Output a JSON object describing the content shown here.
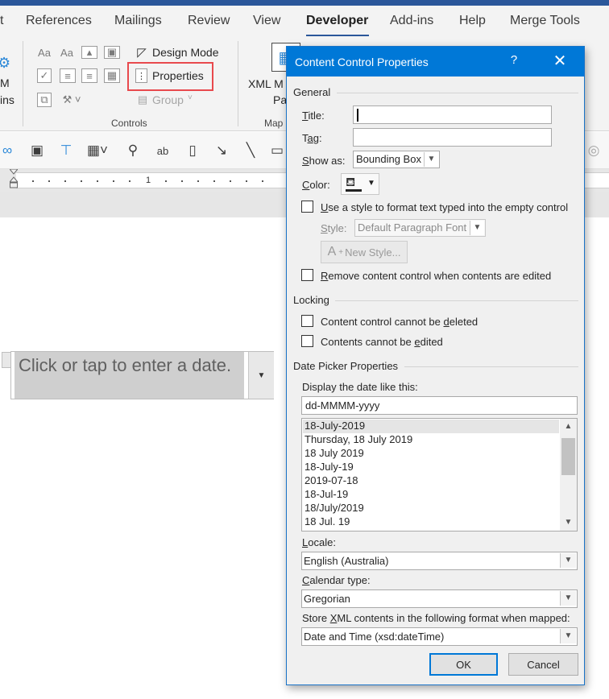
{
  "ribbon_tabs": [
    "t",
    "References",
    "Mailings",
    "Review",
    "View",
    "Developer",
    "Add-ins",
    "Help",
    "Merge Tools"
  ],
  "active_tab": "Developer",
  "ribbon": {
    "left_cut_1": "M",
    "left_cut_2": "ins",
    "design_mode": "Design Mode",
    "properties": "Properties",
    "group": "Group",
    "controls_group": "Controls",
    "xml_mapping": "XML M",
    "xml_mapping_2": "Pa",
    "mapping_group": "Map"
  },
  "ruler": {
    "mark": "1"
  },
  "document": {
    "placeholder": "Click or tap to enter a date."
  },
  "dialog": {
    "title": "Content Control Properties",
    "help": "?",
    "close": "✕",
    "general": {
      "heading": "General",
      "title_label": "Title:",
      "tag_label": "Tag:",
      "show_as_label": "Show as:",
      "show_as_value": "Bounding Box",
      "color_label": "Color:",
      "use_style_label": "Use a style to format text typed into the empty control",
      "style_label": "Style:",
      "style_value": "Default Paragraph Font",
      "new_style_button": "New Style...",
      "remove_label": "Remove content control when contents are edited"
    },
    "locking": {
      "heading": "Locking",
      "cannot_delete": "Content control cannot be deleted",
      "cannot_edit": "Contents cannot be edited"
    },
    "date_picker": {
      "heading": "Date Picker Properties",
      "display_label": "Display the date like this:",
      "format_value": "dd-MMMM-yyyy",
      "formats": [
        "18-July-2019",
        "Thursday, 18 July 2019",
        "18 July 2019",
        "18-July-19",
        "2019-07-18",
        "18-Jul-19",
        "18/July/2019",
        "18 Jul. 19"
      ],
      "selected_index": 0,
      "locale_label": "Locale:",
      "locale_value": "English (Australia)",
      "calendar_label": "Calendar type:",
      "calendar_value": "Gregorian",
      "store_label": "Store XML contents in the following format when mapped:",
      "store_value": "Date and Time (xsd:dateTime)"
    },
    "ok_button": "OK",
    "cancel_button": "Cancel"
  }
}
